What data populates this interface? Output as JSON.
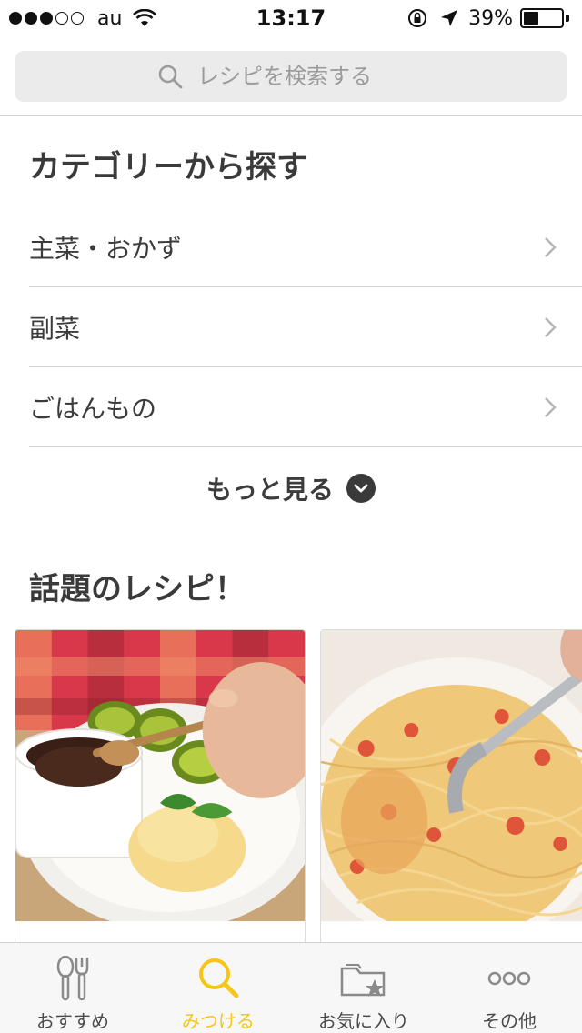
{
  "status_bar": {
    "carrier": "au",
    "time": "13:17",
    "battery_percent_label": "39%",
    "battery_level": 0.39,
    "signal_bars_filled": 3,
    "signal_bars_total": 5
  },
  "search": {
    "placeholder": "レシピを検索する"
  },
  "categories_section": {
    "title": "カテゴリーから探す",
    "items": [
      {
        "label": "主菜・おかず"
      },
      {
        "label": "副菜"
      },
      {
        "label": "ごはんもの"
      }
    ],
    "more_label": "もっと見る"
  },
  "trending_section": {
    "title": "話題のレシピ！",
    "cards": [
      {
        "photo": "chocolate-pudding-with-kiwi-and-ice-cream-photo"
      },
      {
        "photo": "tomato-cream-pasta-photo"
      }
    ]
  },
  "tab_bar": {
    "active_tab": "find",
    "accent_color": "#f5c518",
    "tabs": [
      {
        "id": "recommended",
        "label": "おすすめ",
        "icon": "spoon-fork-icon"
      },
      {
        "id": "find",
        "label": "みつける",
        "icon": "search-icon"
      },
      {
        "id": "favorites",
        "label": "お気に入り",
        "icon": "folder-star-icon"
      },
      {
        "id": "other",
        "label": "その他",
        "icon": "more-dots-icon"
      }
    ]
  }
}
